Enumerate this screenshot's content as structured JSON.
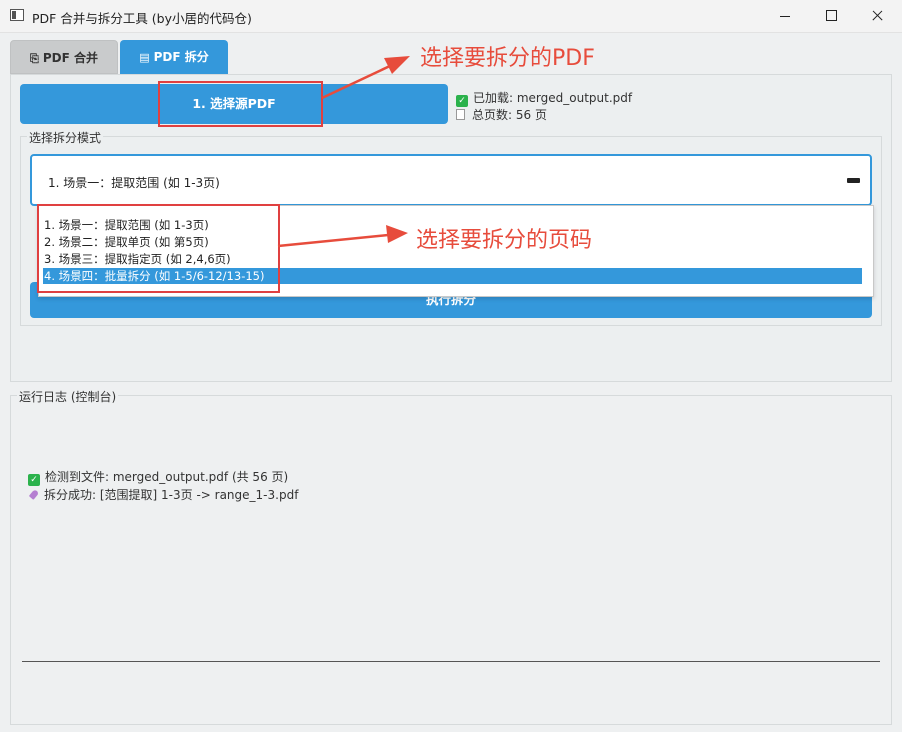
{
  "window": {
    "title": "PDF 合并与拆分工具 (by小居的代码仓)"
  },
  "tabs": [
    {
      "label": "PDF 合并",
      "icon": "⎘"
    },
    {
      "label": "PDF 拆分",
      "icon": "▤"
    }
  ],
  "source": {
    "button_label": "1. 选择源PDF",
    "loaded_text": "已加载: merged_output.pdf",
    "pages_text": "总页数: 56 页"
  },
  "mode": {
    "group_label": "选择拆分模式",
    "selected": "1. 场景一：提取范围 (如 1-3页)",
    "options": [
      "1. 场景一：提取范围 (如 1-3页)",
      "2. 场景二：提取单页 (如 第5页)",
      "3. 场景三：提取指定页 (如 2,4,6页)",
      "4. 场景四：批量拆分 (如 1-5/6-12/13-15)"
    ],
    "highlighted_index": 3,
    "execute_label": "执行拆分"
  },
  "annotations": {
    "top": "选择要拆分的PDF",
    "middle": "选择要拆分的页码"
  },
  "log": {
    "group_label": "运行日志 (控制台)",
    "lines": [
      "检测到文件: merged_output.pdf (共 56 页)",
      "拆分成功: [范围提取] 1-3页 -> range_1-3.pdf"
    ]
  },
  "colors": {
    "accent": "#3498db",
    "annotation": "#e74c3c",
    "success": "#2bb24c"
  }
}
